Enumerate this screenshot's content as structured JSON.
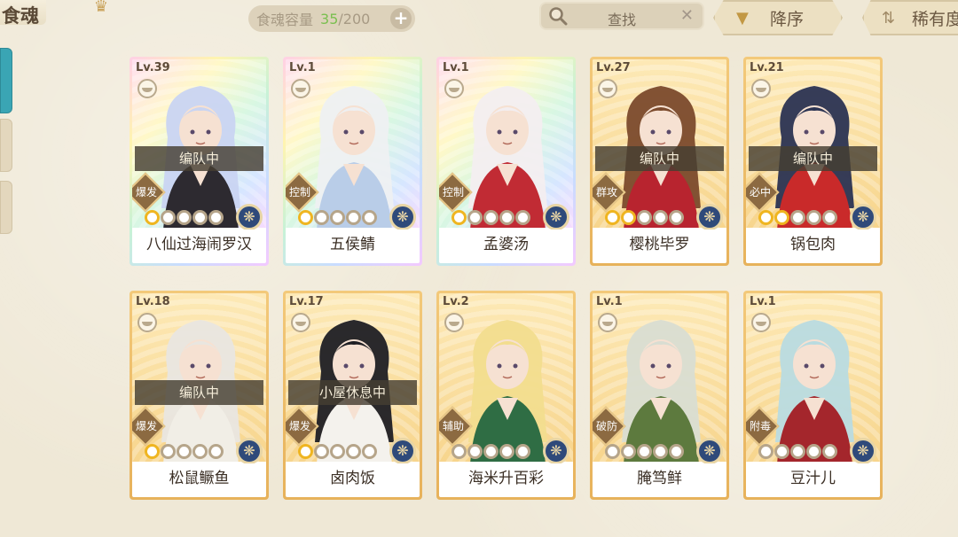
{
  "header": {
    "title": "食魂",
    "capacity_label": "食魂容量",
    "capacity_current": "35",
    "capacity_sep": "/200",
    "add_icon": "+",
    "search_label": "查找",
    "sort_desc_label": "降序",
    "sort_rarity_label": "稀有度"
  },
  "cards": [
    {
      "level": "Lv.39",
      "status": "编队中",
      "role": "爆发",
      "name": "八仙过海闹罗汉",
      "stars_on": 1,
      "frame": "rainbow",
      "hair": "#c9d4f2",
      "outfit": "#2d2a30"
    },
    {
      "level": "Lv.1",
      "status": "",
      "role": "控制",
      "name": "五侯鲭",
      "stars_on": 1,
      "frame": "rainbow",
      "hair": "#eef0f2",
      "outfit": "#b9cde8"
    },
    {
      "level": "Lv.1",
      "status": "",
      "role": "控制",
      "name": "孟婆汤",
      "stars_on": 1,
      "frame": "rainbow",
      "hair": "#f3eef0",
      "outfit": "#c12b34"
    },
    {
      "level": "Lv.27",
      "status": "编队中",
      "role": "群攻",
      "name": "樱桃毕罗",
      "stars_on": 2,
      "frame": "gold",
      "hair": "#7b4a2c",
      "outfit": "#b8242f"
    },
    {
      "level": "Lv.21",
      "status": "编队中",
      "role": "必中",
      "name": "锅包肉",
      "stars_on": 2,
      "frame": "gold",
      "hair": "#2b3352",
      "outfit": "#c92a2a"
    },
    {
      "level": "Lv.18",
      "status": "编队中",
      "role": "爆发",
      "name": "松鼠鳜鱼",
      "stars_on": 1,
      "frame": "gold",
      "hair": "#e9e6e0",
      "outfit": "#f1eee6"
    },
    {
      "level": "Lv.17",
      "status": "小屋休息中",
      "role": "爆发",
      "name": "卤肉饭",
      "stars_on": 1,
      "frame": "gold",
      "hair": "#1f1f24",
      "outfit": "#f4f2ed"
    },
    {
      "level": "Lv.2",
      "status": "",
      "role": "辅助",
      "name": "海米升百彩",
      "stars_on": 0,
      "frame": "gold",
      "hair": "#f2dd8e",
      "outfit": "#2f6d44"
    },
    {
      "level": "Lv.1",
      "status": "",
      "role": "破防",
      "name": "腌笃鲜",
      "stars_on": 0,
      "frame": "gold",
      "hair": "#d9ddd2",
      "outfit": "#5d7a3e"
    },
    {
      "level": "Lv.1",
      "status": "",
      "role": "附毒",
      "name": "豆汁儿",
      "stars_on": 0,
      "frame": "gold",
      "hair": "#b9dbe0",
      "outfit": "#a4262c"
    }
  ],
  "icons": {
    "search": "magnifier-icon",
    "clear": "close-icon",
    "sort": "sort-arrow-icon",
    "bowl": "bowl-icon",
    "emblem": "emblem-icon"
  },
  "colors": {
    "accent_green": "#7bbf50",
    "status_bar": "#463e32",
    "gold_frame": "#e7b25b"
  }
}
